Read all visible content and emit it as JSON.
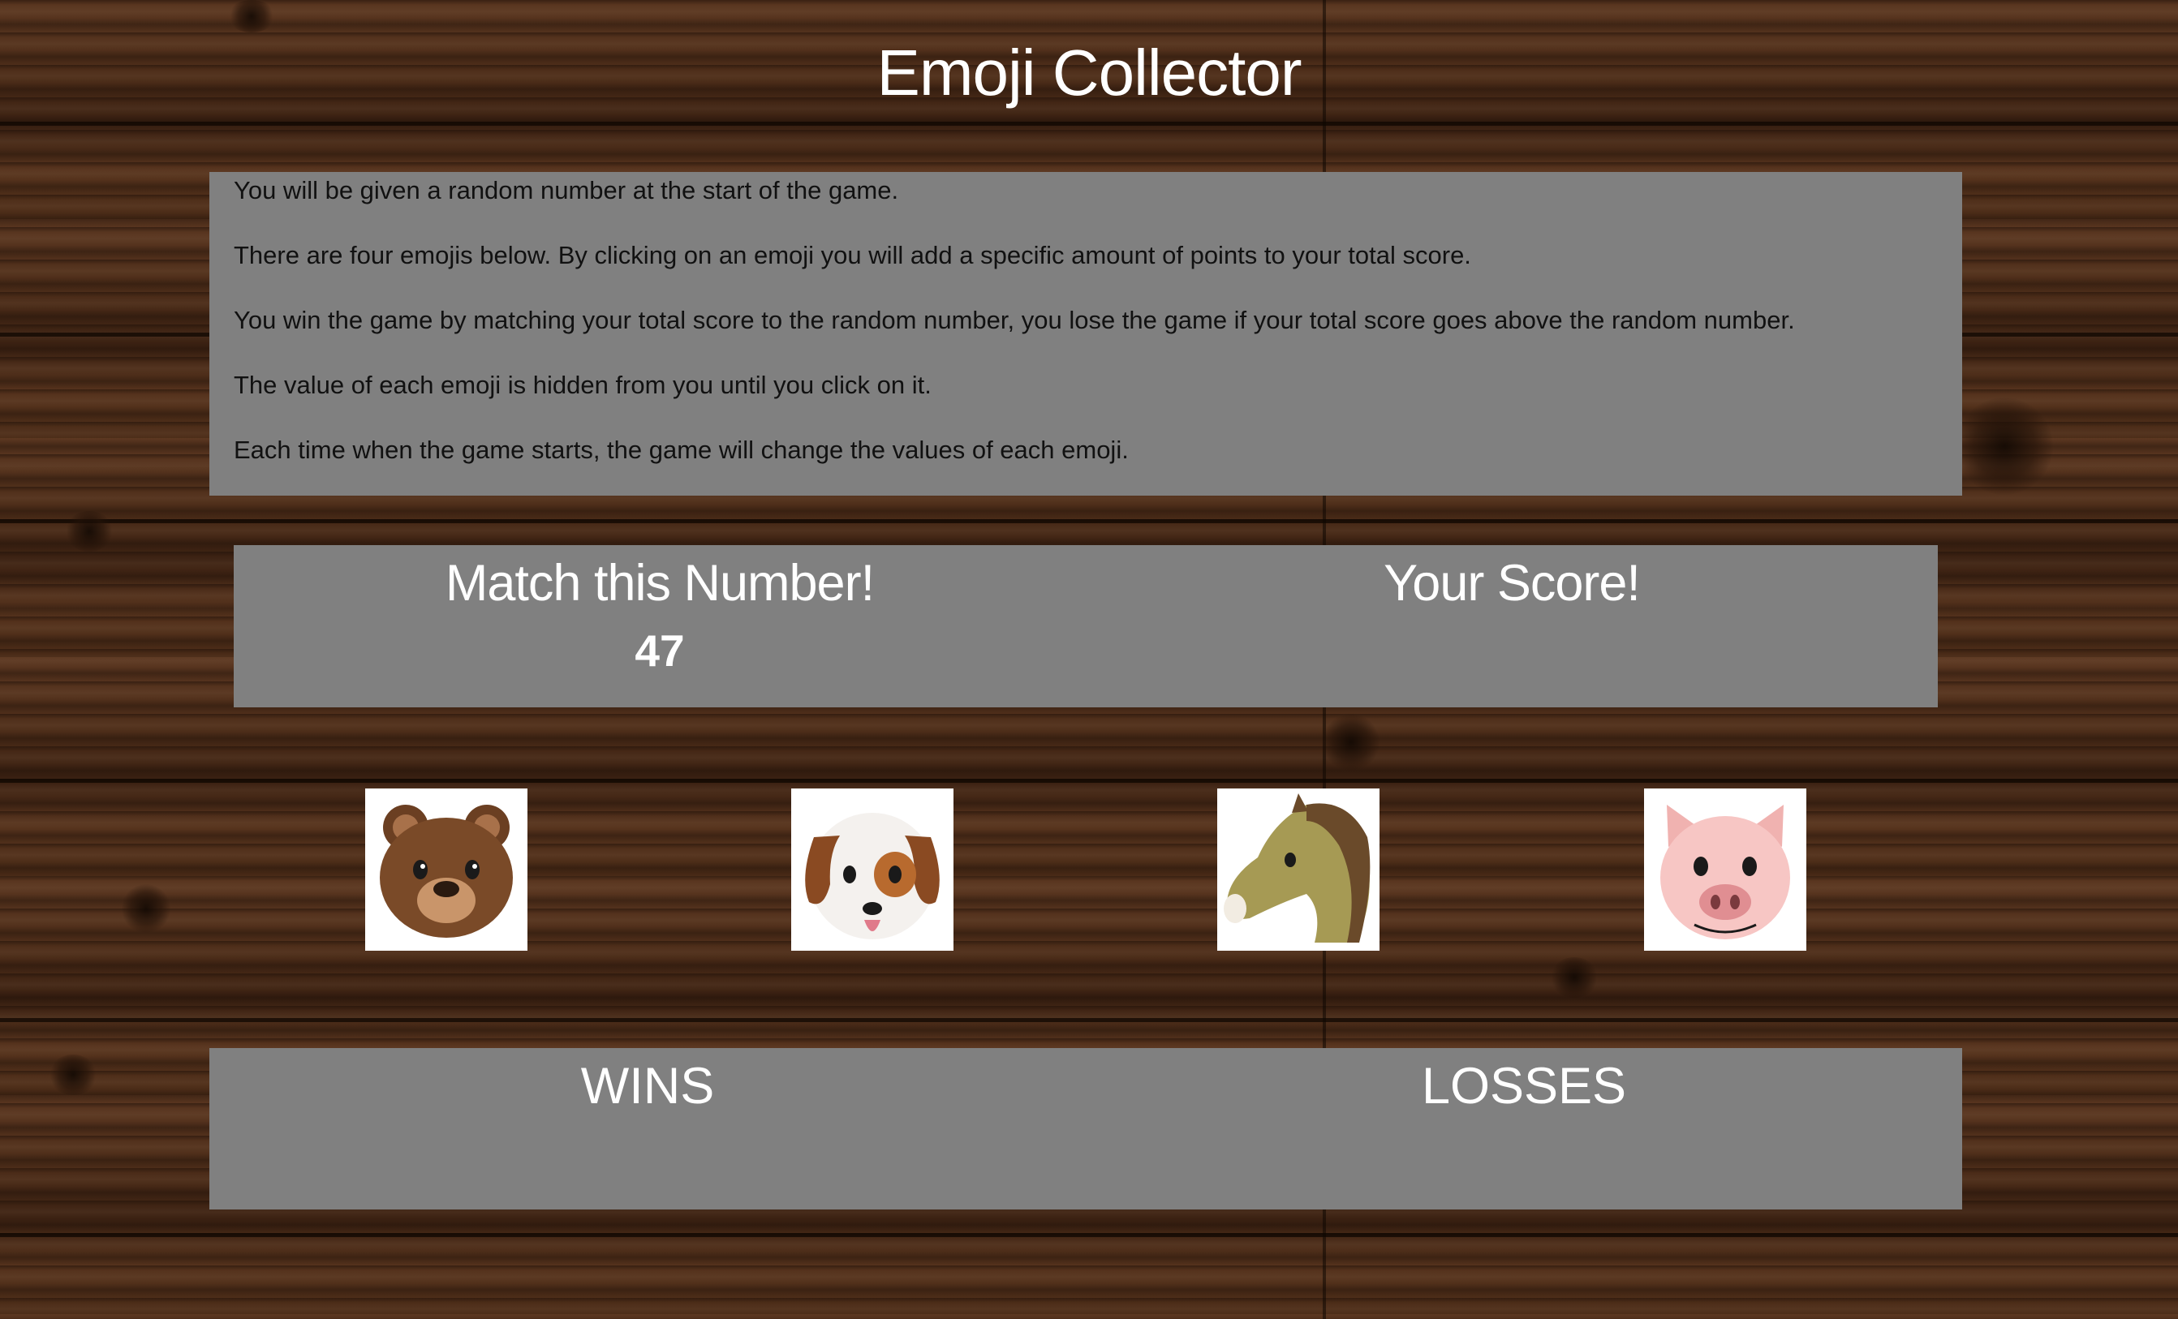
{
  "page": {
    "title": "Emoji Collector"
  },
  "instructions": [
    "You will be given a random number at the start of the game.",
    "There are four emojis below. By clicking on an emoji you will add a specific amount of points to your total score.",
    "You win the game by matching your total score to the random number, you lose the game if your total score goes above the random number.",
    "The value of each emoji is hidden from you until you click on it.",
    "Each time when the game starts, the game will change the values of each emoji."
  ],
  "score_board": {
    "target_label": "Match this Number!",
    "target_value": "47",
    "score_label": "Your Score!",
    "score_value": ""
  },
  "emojis": [
    {
      "name": "bear-emoji"
    },
    {
      "name": "dog-emoji"
    },
    {
      "name": "horse-emoji"
    },
    {
      "name": "pig-emoji"
    }
  ],
  "results": {
    "wins_label": "WINS",
    "wins_value": "",
    "losses_label": "LOSSES",
    "losses_value": ""
  },
  "colors": {
    "panel": "#808080",
    "text_light": "#ffffff",
    "text_dark": "#111111",
    "background": "#4a2c1a"
  }
}
